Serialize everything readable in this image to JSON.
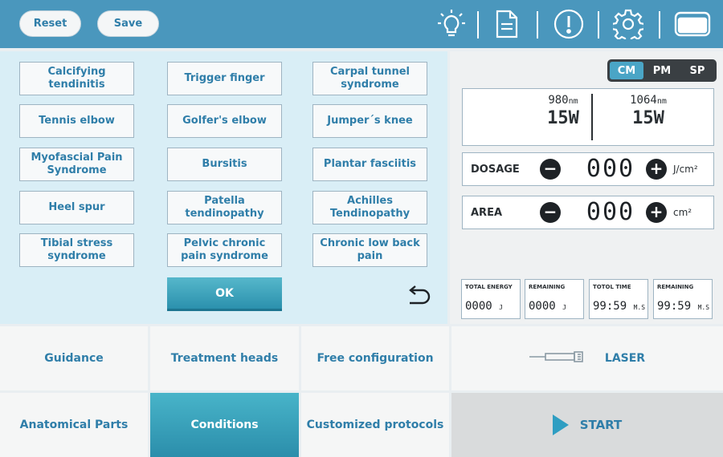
{
  "header": {
    "reset_label": "Reset",
    "save_label": "Save",
    "icons": [
      "lightbulb-icon",
      "document-icon",
      "alert-icon",
      "gear-icon",
      "display-icon"
    ]
  },
  "conditions": {
    "items": [
      "Calcifying tendinitis",
      "Trigger finger",
      "Carpal tunnel syndrome",
      "Tennis elbow",
      "Golfer's elbow",
      "Jumper´s knee",
      "Myofascial Pain Syndrome",
      "Bursitis",
      "Plantar fasciitis",
      "Heel spur",
      "Patella tendinopathy",
      "Achilles Tendinopathy",
      "Tibial stress syndrome",
      "Pelvic chronic pain syndrome",
      "Chronic low back pain"
    ],
    "ok_label": "OK"
  },
  "laser": {
    "modes": [
      "CM",
      "PM",
      "SP"
    ],
    "active_mode": "CM",
    "wavelengths": [
      {
        "wl": "980",
        "unit": "nm",
        "power": "15W"
      },
      {
        "wl": "1064",
        "unit": "nm",
        "power": "15W"
      }
    ],
    "dosage": {
      "label": "DOSAGE",
      "value": "000",
      "unit": "J/cm²"
    },
    "area": {
      "label": "AREA",
      "value": "000",
      "unit": "cm²"
    },
    "stats": [
      {
        "label": "TOTAL ENERGY",
        "value": "0000",
        "unit": "J"
      },
      {
        "label": "REMAINING",
        "value": "0000",
        "unit": "J"
      },
      {
        "label": "TOTOL TIME",
        "value": "99:59",
        "unit": "M.S"
      },
      {
        "label": "REMAINING",
        "value": "99:59",
        "unit": "M.S"
      }
    ]
  },
  "tabs": {
    "guidance": "Guidance",
    "treatment_heads": "Treatment heads",
    "free_configuration": "Free configuration",
    "anatomical_parts": "Anatomical Parts",
    "conditions": "Conditions",
    "customized_protocols": "Customized protocols",
    "laser": "LASER",
    "start": "START"
  },
  "colors": {
    "header": "#4a97bd",
    "accent": "#2f7ea9",
    "active_tab": "#2b8eab",
    "panel": "#d9eef6"
  }
}
